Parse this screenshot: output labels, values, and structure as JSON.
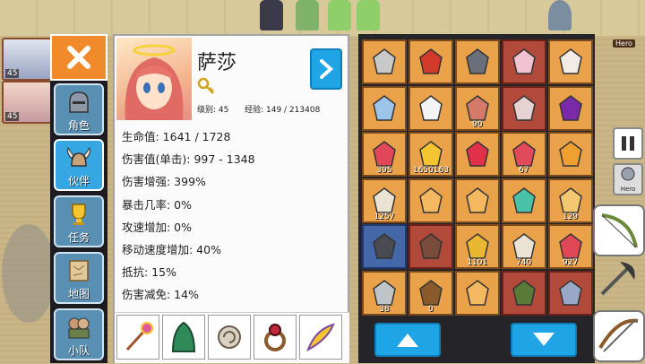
{
  "party_portraits": [
    {
      "level": "45"
    },
    {
      "level": "45"
    }
  ],
  "tabs": [
    {
      "label": "角色",
      "icon": "helmet-icon"
    },
    {
      "label": "伙伴",
      "icon": "horned-helmet-icon"
    },
    {
      "label": "任务",
      "icon": "trophy-icon"
    },
    {
      "label": "地图",
      "icon": "map-scroll-icon"
    },
    {
      "label": "小队",
      "icon": "party-icon"
    }
  ],
  "hero": {
    "name": "萨莎",
    "level_label": "级别: 45",
    "exp_label": "经验: 149 / 213408"
  },
  "stats": [
    "生命值: 1641 / 1728",
    "伤害值(单击): 997 - 1348",
    "伤害增强: 399%",
    "暴击几率: 0%",
    "攻速增加: 0%",
    "移动速度增加: 40%",
    "抵抗: 15%",
    "伤害减免: 14%"
  ],
  "equipment": [
    {
      "icon": "magic-staff-icon"
    },
    {
      "icon": "green-cloak-icon"
    },
    {
      "icon": "shell-charm-icon"
    },
    {
      "icon": "ruby-ring-icon"
    },
    {
      "icon": "feather-quill-icon"
    }
  ],
  "inventory": [
    {
      "icon": "drill-icon",
      "count": "",
      "style": "normal"
    },
    {
      "icon": "firecracker-icon",
      "count": "",
      "style": "normal"
    },
    {
      "icon": "armor-icon",
      "count": "",
      "style": "normal"
    },
    {
      "icon": "pink-feather-icon",
      "count": "",
      "style": "red"
    },
    {
      "icon": "white-gem-icon",
      "count": "",
      "style": "normal"
    },
    {
      "icon": "sword-icon",
      "count": "",
      "style": "normal"
    },
    {
      "icon": "white-feather-icon",
      "count": "",
      "style": "normal"
    },
    {
      "icon": "meat-icon",
      "count": "90",
      "style": "normal"
    },
    {
      "icon": "hooded-cloak-icon",
      "count": "",
      "style": "red"
    },
    {
      "icon": "purple-bracer-icon",
      "count": "",
      "style": "normal"
    },
    {
      "icon": "red-gem-icon",
      "count": "395",
      "style": "normal"
    },
    {
      "icon": "gold-coins-icon",
      "count": "1650163",
      "style": "normal"
    },
    {
      "icon": "red-potion-icon",
      "count": "",
      "style": "normal"
    },
    {
      "icon": "potion-bottle-icon",
      "count": "67",
      "style": "normal"
    },
    {
      "icon": "amulet-icon",
      "count": "",
      "style": "normal"
    },
    {
      "icon": "scroll-icon",
      "count": "1257",
      "style": "normal"
    },
    {
      "icon": "orange-crystal-icon",
      "count": "",
      "style": "normal"
    },
    {
      "icon": "orange-crystal-icon",
      "count": "",
      "style": "normal"
    },
    {
      "icon": "teal-crystal-icon",
      "count": "",
      "style": "normal"
    },
    {
      "icon": "gold-orb-icon",
      "count": "129",
      "style": "normal"
    },
    {
      "icon": "dark-gauntlet-icon",
      "count": "",
      "style": "blue"
    },
    {
      "icon": "horn-helmet-icon",
      "count": "",
      "style": "red"
    },
    {
      "icon": "gold-key-icon",
      "count": "1101",
      "style": "normal"
    },
    {
      "icon": "scroll-icon",
      "count": "740",
      "style": "normal"
    },
    {
      "icon": "potion-stack-icon",
      "count": "927",
      "style": "normal"
    },
    {
      "icon": "silver-ingot-icon",
      "count": "38",
      "style": "normal"
    },
    {
      "icon": "wood-pile-icon",
      "count": "0",
      "style": "normal"
    },
    {
      "icon": "orange-crystal-icon",
      "count": "",
      "style": "normal"
    },
    {
      "icon": "thorn-vine-icon",
      "count": "",
      "style": "red"
    },
    {
      "icon": "silver-ring-icon",
      "count": "",
      "style": "red"
    }
  ],
  "hud": {
    "hero_button_label": "Hero",
    "tag_label": "Hero"
  },
  "colors": {
    "accent_blue": "#1fa5e6",
    "close_orange": "#f08a2a",
    "slot_orange": "#eaa24a",
    "slot_red": "#b24a3c",
    "slot_blue": "#4467a8"
  }
}
